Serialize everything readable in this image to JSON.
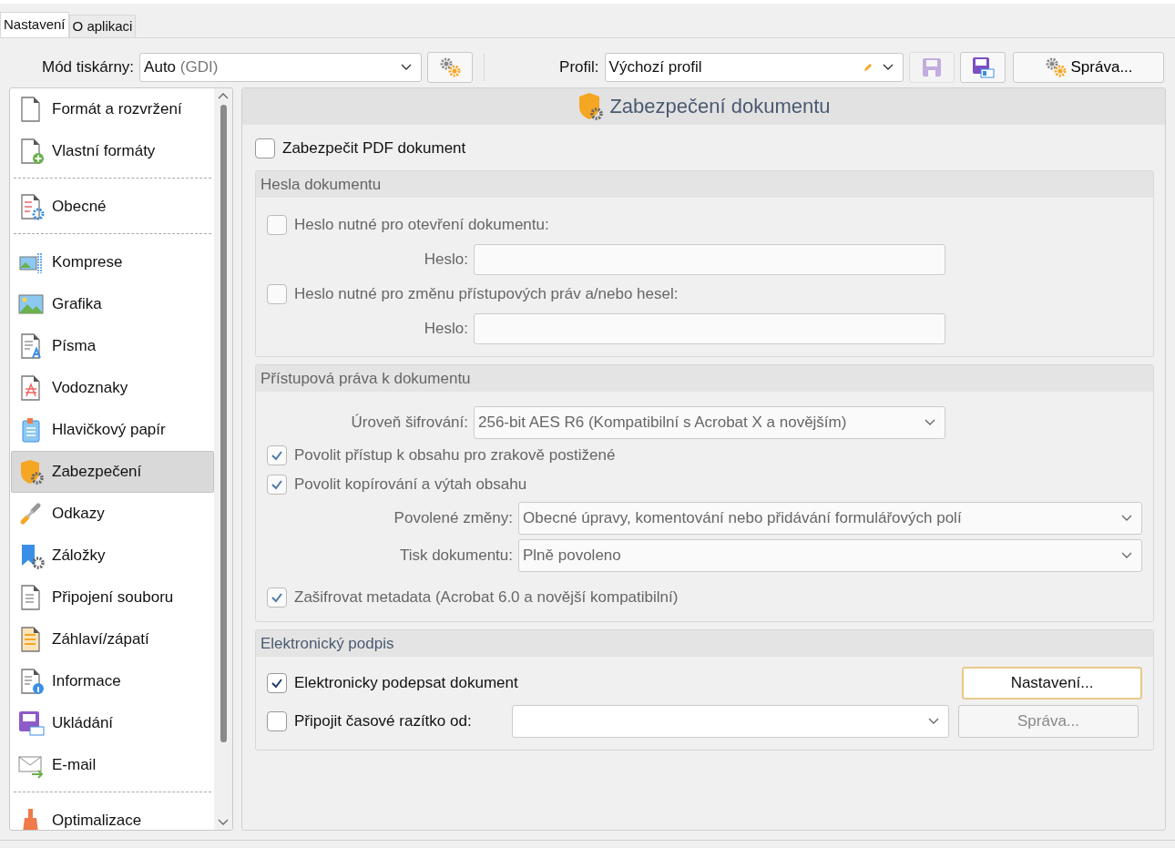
{
  "tabs": [
    {
      "label": "Nastavení",
      "selected": true
    },
    {
      "label": "O aplikaci",
      "selected": false
    }
  ],
  "toolbar": {
    "printer_mode": {
      "label": "Mód tiskárny:",
      "value": "Auto",
      "hint": "(GDI)"
    },
    "profile": {
      "label": "Profil:",
      "value": "Výchozí profil"
    },
    "save_button": {
      "disabled": true
    },
    "manage_button": {
      "label": "Správa..."
    }
  },
  "sidebar": {
    "groups": [
      {
        "items": [
          {
            "label": "Formát a rozvržení",
            "kind": "page",
            "selected": false
          },
          {
            "label": "Vlastní formáty",
            "kind": "page-plus",
            "selected": false
          }
        ]
      },
      {
        "items": [
          {
            "label": "Obecné",
            "kind": "checklist",
            "selected": false
          }
        ]
      },
      {
        "items": [
          {
            "label": "Komprese",
            "kind": "compress",
            "selected": false
          },
          {
            "label": "Grafika",
            "kind": "image",
            "selected": false
          },
          {
            "label": "Písma",
            "kind": "font",
            "selected": false
          },
          {
            "label": "Vodoznaky",
            "kind": "watermark",
            "selected": false
          },
          {
            "label": "Hlavičkový papír",
            "kind": "letterhead",
            "selected": false
          },
          {
            "label": "Zabezpečení",
            "kind": "shield",
            "selected": true
          },
          {
            "label": "Odkazy",
            "kind": "link",
            "selected": false
          },
          {
            "label": "Záložky",
            "kind": "bookmark",
            "selected": false
          },
          {
            "label": "Připojení souboru",
            "kind": "attach",
            "selected": false
          },
          {
            "label": "Záhlaví/zápatí",
            "kind": "header",
            "selected": false
          },
          {
            "label": "Informace",
            "kind": "info",
            "selected": false
          },
          {
            "label": "Ukládání",
            "kind": "save",
            "selected": false
          },
          {
            "label": "E-mail",
            "kind": "mail",
            "selected": false
          }
        ]
      },
      {
        "items": [
          {
            "label": "Optimalizace",
            "kind": "brush",
            "selected": false
          }
        ]
      }
    ]
  },
  "panel": {
    "title": "Zabezpečení dokumentu",
    "protect": {
      "label": "Zabezpečit PDF dokument",
      "checked": false
    },
    "passwords": {
      "title": "Hesla dokumentu",
      "disabled": true,
      "rows": [
        {
          "label": "Heslo nutné pro otevření dokumentu:",
          "checked": false,
          "field_label": "Heslo:"
        },
        {
          "label": "Heslo nutné pro změnu přístupových práv a/nebo hesel:",
          "checked": false,
          "field_label": "Heslo:"
        }
      ]
    },
    "permissions": {
      "title": "Přístupová práva k dokumentu",
      "disabled": true,
      "encryption": {
        "label": "Úroveň šifrování:",
        "value": "256-bit AES R6 (Kompatibilní s Acrobat X a novějším)"
      },
      "options": [
        {
          "label": "Povolit přístup k obsahu pro zrakově postižené",
          "checked": true
        },
        {
          "label": "Povolit kopírování a výtah obsahu",
          "checked": true
        }
      ],
      "selects": [
        {
          "label": "Povolené změny:",
          "value": "Obecné úpravy, komentování nebo přidávání formulářových polí"
        },
        {
          "label": "Tisk dokumentu:",
          "value": "Plně povoleno"
        }
      ],
      "metadata": {
        "label": "Zašifrovat metadata (Acrobat 6.0 a novější kompatibilní)",
        "checked": true
      }
    },
    "signature": {
      "title": "Elektronický podpis",
      "disabled": false,
      "sign": {
        "label": "Elektronicky podepsat dokument",
        "checked": true
      },
      "settings_button": {
        "label": "Nastavení...",
        "focused": true
      },
      "timestamp": {
        "label": "Připojit časové razítko od:",
        "checked": false
      },
      "manage_button": {
        "label": "Správa...",
        "disabled": true
      }
    }
  }
}
